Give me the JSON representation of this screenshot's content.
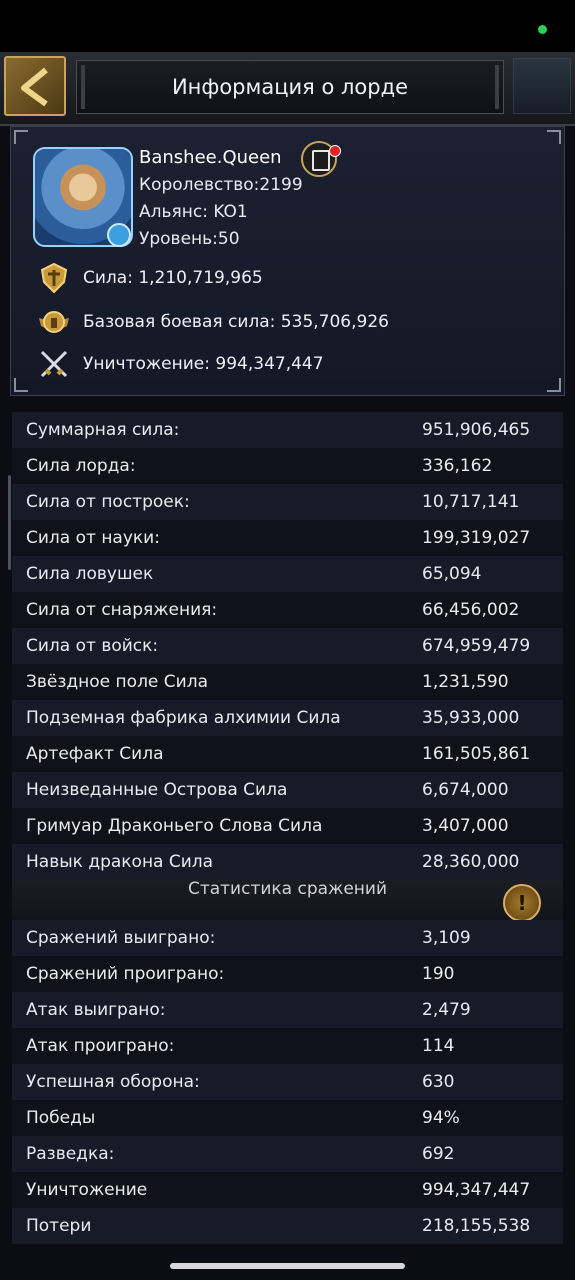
{
  "header": {
    "title": "Информация о лорде"
  },
  "profile": {
    "name": "Banshee.Queen",
    "kingdom": "Королевство:2199",
    "alliance": "Альянс: KO1",
    "level": "Уровень:50",
    "power": "Сила: 1,210,719,965",
    "base_power": "Базовая боевая сила: 535,706,926",
    "kills": "Уничтожение: 994,347,447"
  },
  "power_rows": [
    {
      "label": "Суммарная сила:",
      "value": "951,906,465"
    },
    {
      "label": "Сила лорда:",
      "value": "336,162"
    },
    {
      "label": "Сила от построек:",
      "value": "10,717,141"
    },
    {
      "label": "Сила от науки:",
      "value": "199,319,027"
    },
    {
      "label": "Сила ловушек",
      "value": "65,094"
    },
    {
      "label": "Сила от снаряжения:",
      "value": "66,456,002"
    },
    {
      "label": "Сила от войск:",
      "value": "674,959,479"
    },
    {
      "label": "Звёздное поле Сила",
      "value": "1,231,590"
    },
    {
      "label": "Подземная фабрика алхимии Сила",
      "value": "35,933,000"
    },
    {
      "label": "Артефакт Сила",
      "value": "161,505,861"
    },
    {
      "label": "Неизведанные Острова Сила",
      "value": "6,674,000"
    },
    {
      "label": "Гримуар Драконьего Слова Сила",
      "value": "3,407,000"
    },
    {
      "label": "Навык дракона Сила",
      "value": "28,360,000"
    }
  ],
  "battle_section": {
    "title": "Статистика сражений",
    "info_icon": "!"
  },
  "battle_rows": [
    {
      "label": "Сражений выиграно:",
      "value": "3,109"
    },
    {
      "label": "Сражений проиграно:",
      "value": "190"
    },
    {
      "label": "Атак выиграно:",
      "value": "2,479"
    },
    {
      "label": "Атак проиграно:",
      "value": "114"
    },
    {
      "label": "Успешная оборона:",
      "value": "630"
    },
    {
      "label": "Победы",
      "value": "94%"
    },
    {
      "label": "Разведка:",
      "value": "692"
    },
    {
      "label": "Уничтожение",
      "value": "994,347,447"
    },
    {
      "label": "Потери",
      "value": "218,155,538"
    }
  ]
}
